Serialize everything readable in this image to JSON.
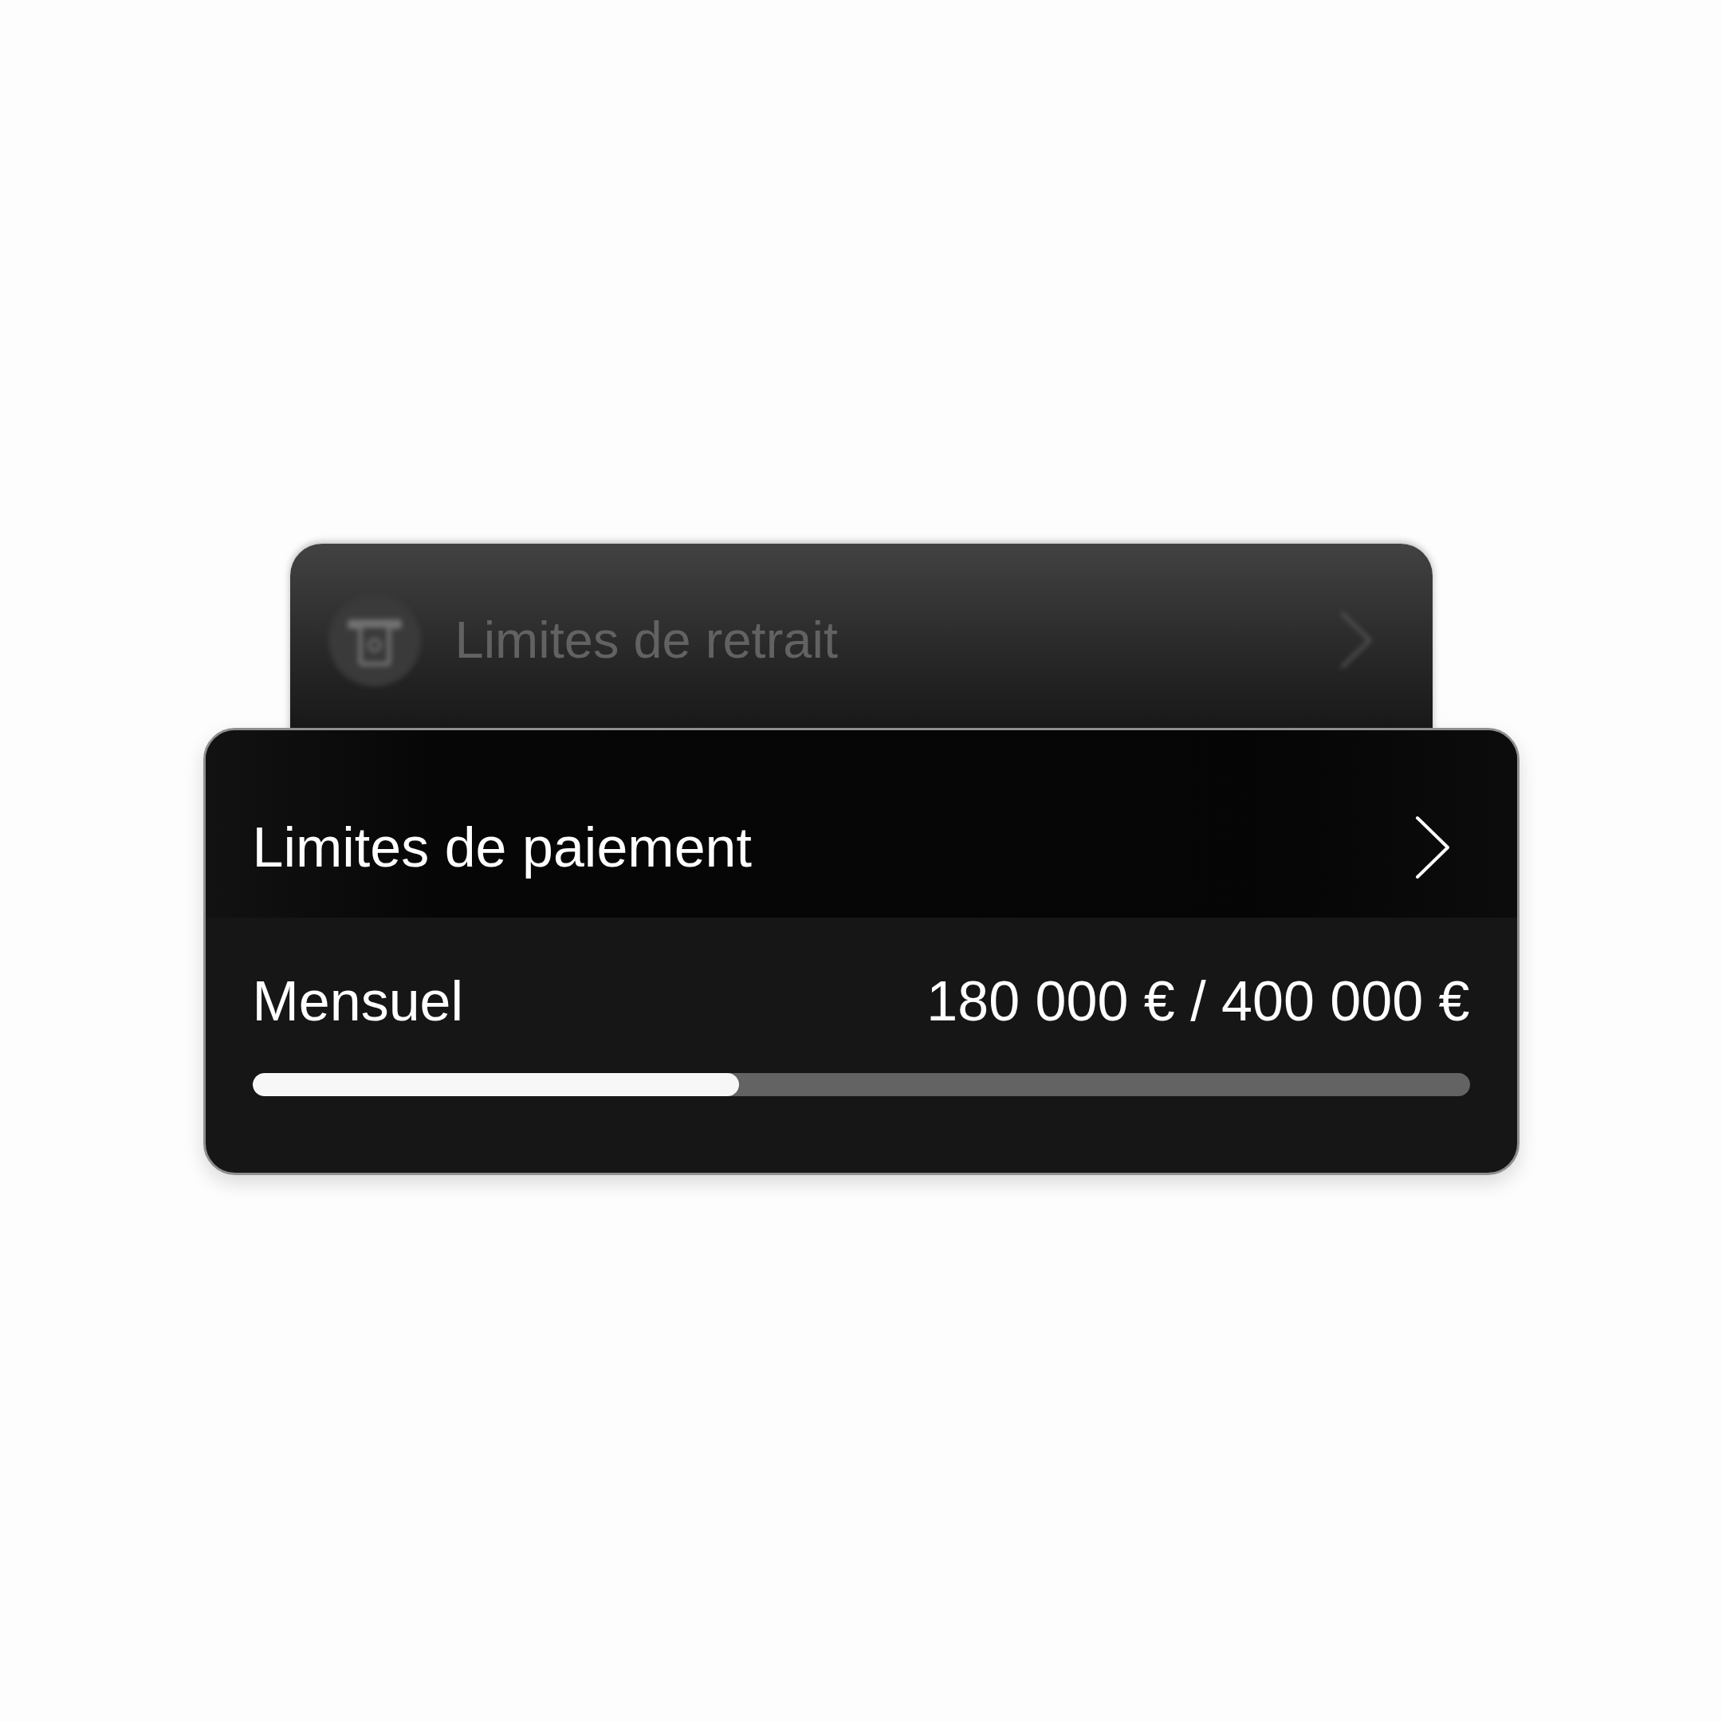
{
  "background_card": {
    "title": "Limites de retrait"
  },
  "card": {
    "title": "Limites de paiement",
    "limit": {
      "period": "Mensuel",
      "amount": "180 000 € / 400 000 €",
      "level": 0.4
    }
  }
}
